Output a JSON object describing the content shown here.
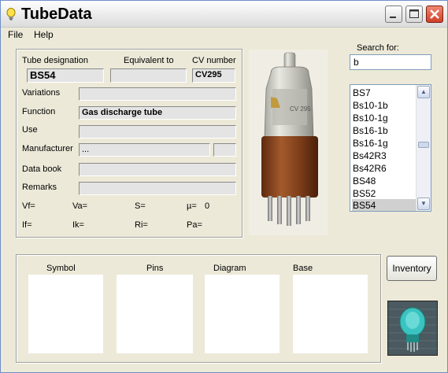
{
  "window": {
    "title": "TubeData"
  },
  "menu": {
    "file": "File",
    "help": "Help"
  },
  "tube": {
    "designation_label": "Tube designation",
    "equivalent_label": "Equivalent to",
    "cv_label": "CV number",
    "designation": "BS54",
    "equivalent": "",
    "cv_number": "CV295",
    "variations_label": "Variations",
    "variations": "",
    "function_label": "Function",
    "function": "Gas discharge tube",
    "use_label": "Use",
    "use": "",
    "manufacturer_label": "Manufacturer",
    "manufacturer": "...",
    "manufacturer_code": "",
    "databook_label": "Data book",
    "databook": "",
    "remarks_label": "Remarks",
    "remarks": "",
    "params": {
      "vf": "Vf=",
      "va": "Va=",
      "s": "S=",
      "mu": "µ=",
      "mu_value": "0",
      "if": "If=",
      "ik": "Ik=",
      "ri": "Ri=",
      "pa": "Pa="
    }
  },
  "search": {
    "label": "Search for:",
    "value": "b"
  },
  "list": {
    "items": [
      "BS7",
      "Bs10-1b",
      "Bs10-1g",
      "Bs16-1b",
      "Bs16-1g",
      "Bs42R3",
      "Bs42R6",
      "BS48",
      "BS52",
      "BS54"
    ],
    "selected": "BS54"
  },
  "panels": {
    "symbol": "Symbol",
    "pins": "Pins",
    "diagram": "Diagram",
    "base": "Base"
  },
  "buttons": {
    "inventory": "Inventory"
  },
  "photo": {
    "tube_label": "CV 295"
  },
  "icons": {
    "app": "lightbulb-icon",
    "minimize": "minimize-icon",
    "maximize": "maximize-icon",
    "close": "close-icon",
    "scroll_up": "scroll-up-icon",
    "scroll_down": "scroll-down-icon"
  }
}
